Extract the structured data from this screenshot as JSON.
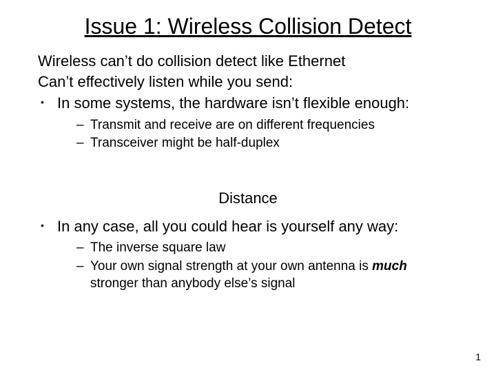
{
  "title": "Issue 1: Wireless Collision Detect",
  "lead1": "Wireless can’t do collision detect like Ethernet",
  "lead2": "Can’t effectively listen while you send:",
  "bullet1": "In some systems, the hardware isn’t flexible enough:",
  "sub1a": "Transmit and receive are on different frequencies",
  "sub1b": "Transceiver might be half-duplex",
  "subhead": "Distance",
  "bullet2": "In any case, all you could hear is yourself any way:",
  "sub2a": "The inverse square law",
  "sub2b_pre": "Your own signal strength at your own antenna is ",
  "sub2b_em": "much",
  "sub2b_post": " stronger than anybody else’s signal",
  "pagenum": "1"
}
